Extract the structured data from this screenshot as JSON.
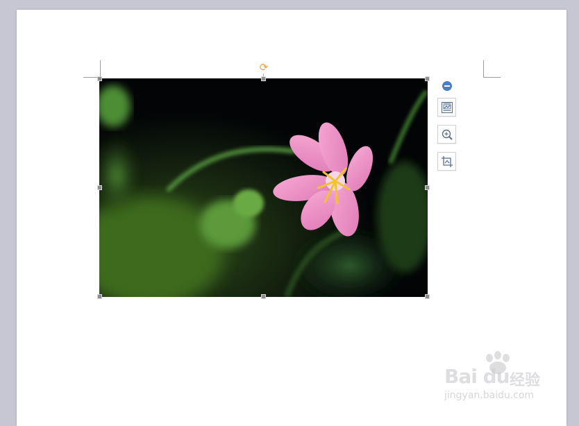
{
  "document": {
    "image_alt": "Pink lily flower with green leaves on dark background"
  },
  "image_toolbar": {
    "tools": [
      {
        "name": "layout-options",
        "icon": "layout-options-icon"
      },
      {
        "name": "zoom-in",
        "icon": "zoom-in-icon"
      },
      {
        "name": "crop",
        "icon": "crop-icon"
      }
    ]
  },
  "watermark": {
    "logo": "Bai du",
    "experience": "经验",
    "url": "jingyan.baidu.com"
  },
  "colors": {
    "rotate_handle": "#e9a13b",
    "collapse_button": "#4d7fc2",
    "page_background": "#ffffff",
    "workspace_background": "#c6c7d3"
  }
}
